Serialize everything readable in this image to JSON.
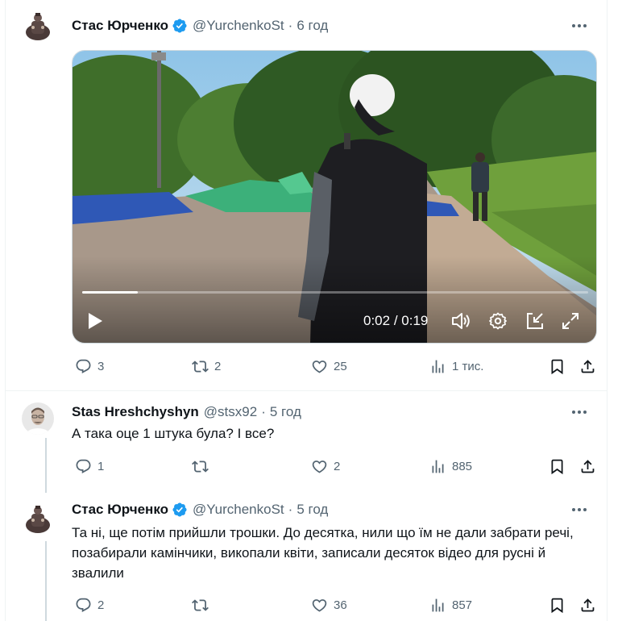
{
  "tweets": [
    {
      "name": "Стас Юрченко",
      "handle": "@YurchenkoSt",
      "time": "6 год",
      "video": {
        "current": "0:02",
        "duration": "0:19",
        "progress": 0.11
      },
      "stats": {
        "replies": "3",
        "reposts": "2",
        "likes": "25",
        "views": "1 тис."
      }
    },
    {
      "name": "Stas Hreshchyshyn",
      "handle": "@stsx92",
      "time": "5 год",
      "text": "А така оце 1 штука була? І все?",
      "stats": {
        "replies": "1",
        "reposts": "",
        "likes": "2",
        "views": "885"
      }
    },
    {
      "name": "Стас Юрченко",
      "handle": "@YurchenkoSt",
      "time": "5 год",
      "text": "Та ні, ще потім прийшли трошки. До десятка, нили що їм не дали забрати речі, позабирали камінчики, викопали квіти, записали десяток відео для русні й звалили",
      "stats": {
        "replies": "2",
        "reposts": "",
        "likes": "36",
        "views": "857"
      }
    }
  ],
  "video_time_sep": " / ",
  "colors": {
    "verified": "#1d9bf0",
    "text_secondary": "#536471",
    "thread_line": "#cfd9de"
  }
}
